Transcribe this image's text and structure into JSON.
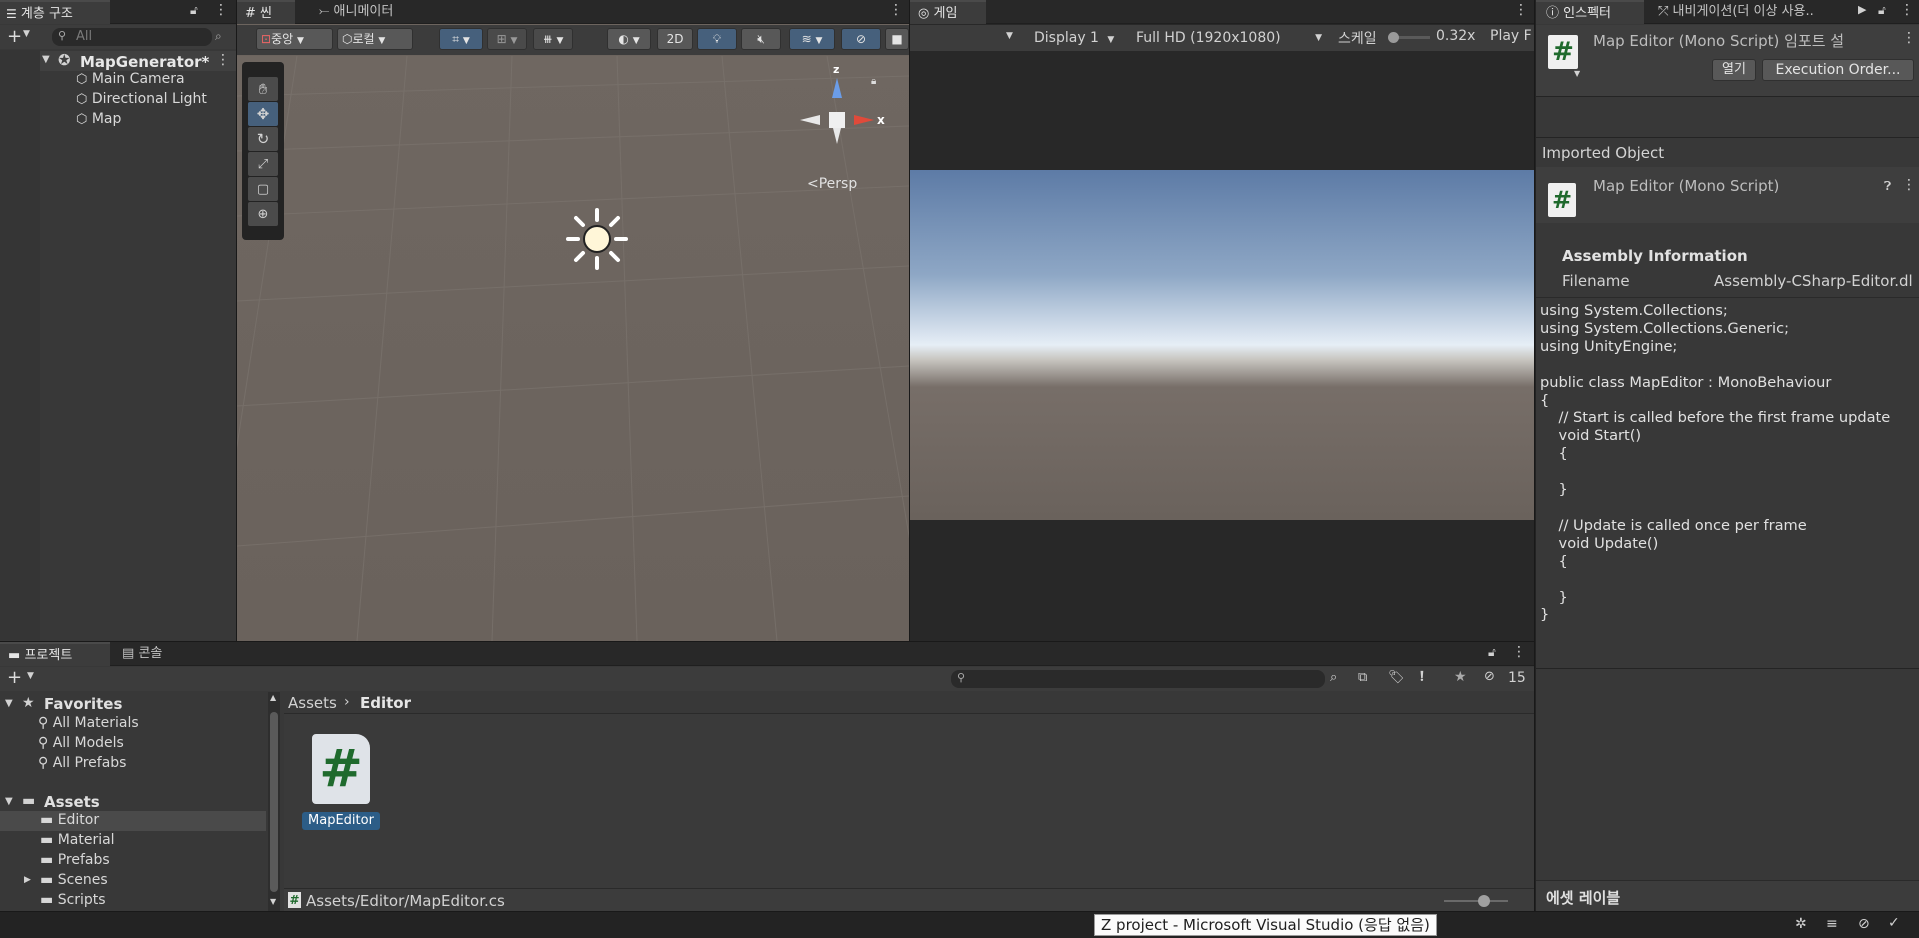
{
  "hierarchy": {
    "tab_label": "계층 구조",
    "search_placeholder": "All",
    "scene_name": "MapGenerator*",
    "items": [
      {
        "label": "Main Camera"
      },
      {
        "label": "Directional Light"
      },
      {
        "label": "Map"
      }
    ]
  },
  "scene": {
    "tab_scene": "씬",
    "tab_animator": "애니메이터",
    "pivot_label": "중앙",
    "space_label": "로컬",
    "btn_2d": "2D",
    "persp_label": "Persp",
    "gizmo_x": "x",
    "gizmo_z": "z"
  },
  "game": {
    "tab_label": "게임",
    "display": "Display 1",
    "resolution": "Full HD (1920x1080)",
    "scale_label": "스케일",
    "scale_value": "0.32x",
    "play_label": "Play F"
  },
  "inspector": {
    "tab_inspector": "인스펙터",
    "tab_navigation": "내비게이션(더 이상 사용..",
    "title": "Map Editor (Mono Script) 임포트 설",
    "open_button": "열기",
    "execution_order_button": "Execution Order...",
    "imported_object_label": "Imported Object",
    "script_name": "Map Editor (Mono Script)",
    "assembly_header": "Assembly Information",
    "filename_label": "Filename",
    "filename_value": "Assembly-CSharp-Editor.dl",
    "code_lines": [
      "using System.Collections;",
      "using System.Collections.Generic;",
      "using UnityEngine;",
      "",
      "public class MapEditor : MonoBehaviour",
      "{",
      "    // Start is called before the first frame update",
      "    void Start()",
      "    {",
      "",
      "    }",
      "",
      "    // Update is called once per frame",
      "    void Update()",
      "    {",
      "",
      "    }",
      "}"
    ],
    "asset_labels": "에셋 레이블"
  },
  "project": {
    "tab_project": "프로젝트",
    "tab_console": "콘솔",
    "hidden_count": "15",
    "favorites_label": "Favorites",
    "favorites": [
      {
        "label": "All Materials"
      },
      {
        "label": "All Models"
      },
      {
        "label": "All Prefabs"
      }
    ],
    "assets_label": "Assets",
    "folders": [
      {
        "label": "Editor"
      },
      {
        "label": "Material"
      },
      {
        "label": "Prefabs"
      },
      {
        "label": "Scenes"
      },
      {
        "label": "Scripts"
      }
    ],
    "breadcrumb_root": "Assets",
    "breadcrumb_current": "Editor",
    "asset_name": "MapEditor",
    "asset_path": "Assets/Editor/MapEditor.cs"
  },
  "status": {
    "message": "Z project - Microsoft Visual Studio (응답 없음)"
  },
  "colors": {
    "selection": "#2c5d87",
    "sky_top": "#5f7eaa",
    "ground": "#6a625c",
    "script_icon_green": "#1f6a2d"
  }
}
